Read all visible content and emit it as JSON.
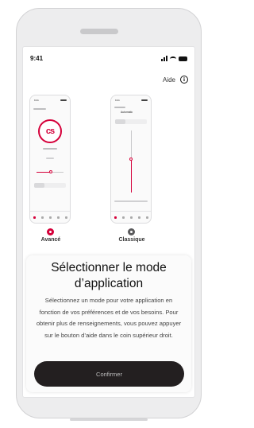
{
  "status_bar": {
    "time": "9:41"
  },
  "header": {
    "help_label": "Aide"
  },
  "modes": [
    {
      "label": "Avancé",
      "selected": true
    },
    {
      "label": "Classique",
      "selected": false
    }
  ],
  "preview_classic": {
    "program": "Automatic"
  },
  "card": {
    "title": "Sélectionner le mode d’application",
    "description": "Sélectionnez un mode pour votre application en fonction de vos préférences et de vos besoins. Pour obtenir plus de renseignements, vous pouvez appuyer sur le bouton d’aide dans le coin supérieur droit.",
    "confirm_label": "Confirmer"
  },
  "colors": {
    "accent": "#d5003a",
    "button": "#231f20"
  }
}
